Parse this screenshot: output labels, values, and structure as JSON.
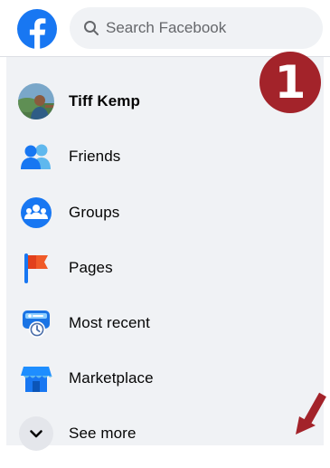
{
  "search": {
    "placeholder": "Search Facebook"
  },
  "menu": {
    "items": [
      {
        "label": "Tiff Kemp",
        "icon": "profile-avatar"
      },
      {
        "label": "Friends",
        "icon": "friends-icon"
      },
      {
        "label": "Groups",
        "icon": "groups-icon"
      },
      {
        "label": "Pages",
        "icon": "pages-flag-icon"
      },
      {
        "label": "Most recent",
        "icon": "most-recent-icon"
      },
      {
        "label": "Marketplace",
        "icon": "marketplace-icon"
      },
      {
        "label": "See more",
        "icon": "chevron-down-icon"
      }
    ]
  },
  "annotation": {
    "step_number": "1"
  },
  "colors": {
    "facebook_blue": "#1877f2",
    "panel_background": "#f0f2f5",
    "annotation_red": "#a3232a"
  }
}
